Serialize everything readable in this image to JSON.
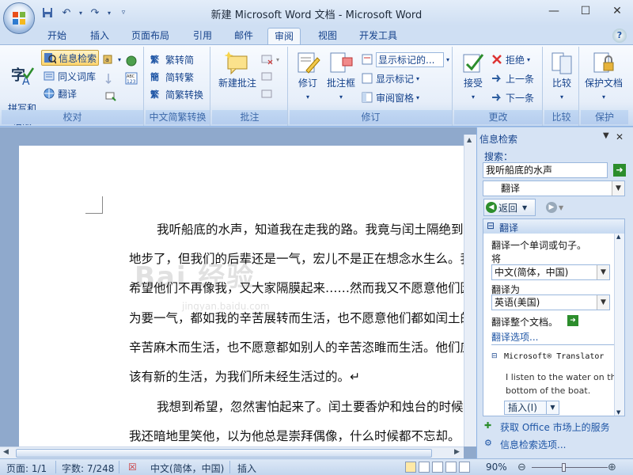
{
  "app": {
    "title": "新建 Microsoft Word 文档 - Microsoft Word",
    "window_controls": [
      "—",
      "☐",
      "✕"
    ]
  },
  "quick_access": {
    "icons": [
      "save-icon",
      "undo-icon",
      "redo-icon",
      "customize-icon"
    ]
  },
  "tabs": [
    "开始",
    "插入",
    "页面布局",
    "引用",
    "邮件",
    "审阅",
    "视图",
    "开发工具"
  ],
  "active_tab": "审阅",
  "ribbon": {
    "proofing": {
      "label": "校对",
      "spelling": "拼写和\n语法",
      "research": "信息检索",
      "thesaurus": "同义词库",
      "translate": "翻译"
    },
    "chinese_conversion": {
      "label": "中文简繁转换",
      "to_simplified": "繁转简",
      "to_traditional": "简转繁",
      "convert": "简繁转换"
    },
    "comments": {
      "label": "批注",
      "new_comment": "新建批注"
    },
    "tracking": {
      "label": "修订",
      "track_changes": "修订",
      "balloons": "批注框",
      "display_for_review": "显示标记的...",
      "show_markup": "显示标记",
      "reviewing_pane": "审阅窗格"
    },
    "changes": {
      "label": "更改",
      "accept": "接受",
      "reject": "拒绝",
      "previous": "上一条",
      "next": "下一条"
    },
    "compare": {
      "label": "比较",
      "compare": "比较"
    },
    "protect": {
      "label": "保护",
      "protect_document": "保护文档"
    }
  },
  "document": {
    "paragraphs": [
      "我听船底的水声，知道我在走我的路。我竟与闰土隔绝到这",
      "地步了，但我们的后辈还是一气，宏儿不是正在想念水生么。我",
      "希望他们不再像我，又大家隔膜起来……然而我又不愿意他们因",
      "为要一气，都如我的辛苦展转而生活，也不愿意他们都如闰土的",
      "辛苦麻木而生活，也不愿意都如别人的辛苦恣睢而生活。他们应",
      "该有新的生活，为我们所未经生活过的。↵",
      "我想到希望，忽然害怕起来了。闰土要香炉和烛台的时候，",
      "我还暗地里笑他，以为他总是崇拜偶像，什么时候都不忘却。"
    ],
    "watermark": "Bai 经验",
    "watermark_url": "jingyan.baidu.com"
  },
  "research_pane": {
    "title": "信息检索",
    "search_label": "搜索：",
    "search_value": "我听船底的水声",
    "service": "翻译",
    "back_label": "返回",
    "section_title": "翻译",
    "translate_word": "翻译一个单词或句子。",
    "from_label": "将",
    "from_lang": "中文(简体，中国)",
    "to_label": "翻译为",
    "to_lang": "英语(美国)",
    "translate_doc": "翻译整个文档。",
    "options_link": "翻译选项...",
    "translator_name": "Microsoft® Translator",
    "translation_line1": "I listen to the water on the",
    "translation_line2": "bottom of the boat.",
    "insert_button": "插入(I)",
    "get_services": "获取 Office 市场上的服务",
    "research_options": "信息检索选项..."
  },
  "statusbar": {
    "page": "页面: 1/1",
    "words": "字数: 7/248",
    "language": "中文(简体，中国)",
    "insert_mode": "插入",
    "zoom": "90%"
  }
}
